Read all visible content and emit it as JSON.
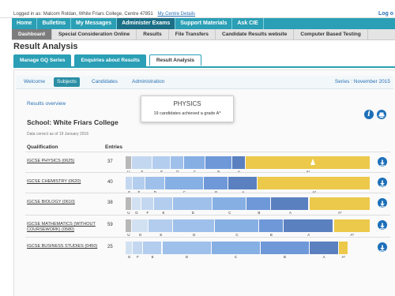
{
  "topbar": {
    "login_text": "Logged in as:  Malcom Roldan, White Friars College, Centre 47851",
    "centre_link": "My Centre Details",
    "logout": "Log o"
  },
  "nav_primary": [
    {
      "label": "Home"
    },
    {
      "label": "Bulletins"
    },
    {
      "label": "My Messages"
    },
    {
      "label": "Administer Exams"
    },
    {
      "label": "Support Materials"
    },
    {
      "label": "Ask CIE"
    }
  ],
  "nav_secondary": [
    {
      "label": "Dashboard"
    },
    {
      "label": "Special Consideration Online"
    },
    {
      "label": "Results"
    },
    {
      "label": "File Transfers"
    },
    {
      "label": "Candidate Results website"
    },
    {
      "label": "Computer Based Testing"
    }
  ],
  "page_title": "Result Analysis",
  "tabs": [
    {
      "label": "Manage GQ Series"
    },
    {
      "label": "Enquiries about Results"
    },
    {
      "label": "Result Analysis"
    }
  ],
  "subtabs": [
    {
      "label": "Welcome"
    },
    {
      "label": "Subjects"
    },
    {
      "label": "Candidates"
    },
    {
      "label": "Administration"
    }
  ],
  "series_label": "Series : November 2015",
  "overview_link": "Results overview",
  "tooltip": {
    "subject": "PHYSICS",
    "detail": "19 candidates achieved a grade A*"
  },
  "school": "School:  White Friars College",
  "date_note": "Data correct as of 19 January 2016",
  "headers": {
    "qualification": "Qualification",
    "entries": "Entries"
  },
  "colors": {
    "U": "#b8b8b8",
    "G": "#d2e1f2",
    "F": "#c3d8f0",
    "E": "#b2cdee",
    "D": "#9fc0ea",
    "C": "#86afe4",
    "B": "#6e98d8",
    "A": "#5a80c0",
    "A*": "#ecc94b"
  },
  "rows": [
    {
      "qualification": "IGCSE PHYSICS (0625)",
      "entries": "37",
      "segments": [
        {
          "grade": "U",
          "share": 0.025
        },
        {
          "grade": "F",
          "share": 0.085
        },
        {
          "grade": "E",
          "share": 0.075
        },
        {
          "grade": "D",
          "share": 0.055
        },
        {
          "grade": "C",
          "share": 0.085
        },
        {
          "grade": "B",
          "share": 0.11
        },
        {
          "grade": "A",
          "share": 0.055
        },
        {
          "grade": "A*",
          "share": 0.51
        }
      ]
    },
    {
      "qualification": "IGCSE CHEMISTRY (0620)",
      "entries": "40",
      "segments": [
        {
          "grade": "F",
          "share": 0.03
        },
        {
          "grade": "E",
          "share": 0.05
        },
        {
          "grade": "D",
          "share": 0.08
        },
        {
          "grade": "C",
          "share": 0.16
        },
        {
          "grade": "B",
          "share": 0.1
        },
        {
          "grade": "A",
          "share": 0.12
        },
        {
          "grade": "A*",
          "share": 0.46
        }
      ]
    },
    {
      "qualification": "IGCSE BIOLOGY (0610)",
      "entries": "38",
      "segments": [
        {
          "grade": "U",
          "share": 0.025
        },
        {
          "grade": "G",
          "share": 0.04
        },
        {
          "grade": "F",
          "share": 0.05
        },
        {
          "grade": "E",
          "share": 0.08
        },
        {
          "grade": "D",
          "share": 0.16
        },
        {
          "grade": "C",
          "share": 0.14
        },
        {
          "grade": "B",
          "share": 0.1
        },
        {
          "grade": "A",
          "share": 0.155
        },
        {
          "grade": "A*",
          "share": 0.25
        }
      ]
    },
    {
      "qualification": "IGCSE MATHEMATICS (WITHOUT COURSEWORK) (0580)",
      "entries": "59",
      "segments": [
        {
          "grade": "U",
          "share": 0.025
        },
        {
          "grade": "G",
          "share": 0.07
        },
        {
          "grade": "E",
          "share": 0.1
        },
        {
          "grade": "D",
          "share": 0.17
        },
        {
          "grade": "C",
          "share": 0.18
        },
        {
          "grade": "B",
          "share": 0.1
        },
        {
          "grade": "A",
          "share": 0.205
        },
        {
          "grade": "A*",
          "share": 0.15
        }
      ]
    },
    {
      "qualification": "IGCSE BUSINESS STUDIES (0450)",
      "entries": "25",
      "segments": [
        {
          "grade": "G",
          "share": 0.03
        },
        {
          "grade": "F",
          "share": 0.04
        },
        {
          "grade": "E",
          "share": 0.08
        },
        {
          "grade": "D",
          "share": 0.2
        },
        {
          "grade": "C",
          "share": 0.2
        },
        {
          "grade": "B",
          "share": 0.2
        },
        {
          "grade": "A",
          "share": 0.12
        },
        {
          "grade": "A*",
          "share": 0.04
        }
      ]
    }
  ]
}
